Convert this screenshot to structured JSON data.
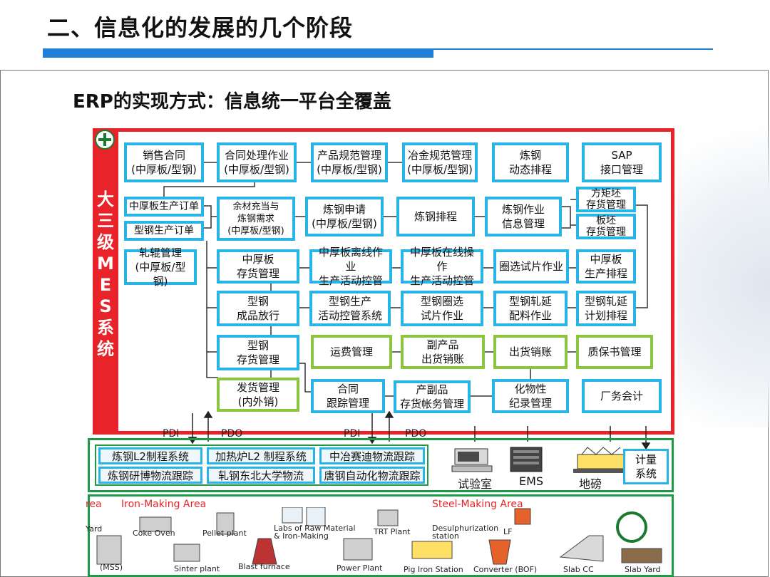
{
  "slide": {
    "title": "二、信息化的发展的几个阶段",
    "subtitle": "ERP的实现方式：信息统一平台全覆盖"
  },
  "mes": {
    "label": "大\n三\n级\nM\nE\nS\n系\n统",
    "boxes": [
      {
        "id": "b1",
        "text": "销售合同\n(中厚板/型钢)",
        "style": "blue"
      },
      {
        "id": "b2",
        "text": "合同处理作业\n(中厚板/型钢)",
        "style": "blue"
      },
      {
        "id": "b3",
        "text": "产品规范管理\n(中厚板/型钢)",
        "style": "blue"
      },
      {
        "id": "b4",
        "text": "冶金规范管理\n(中厚板/型钢)",
        "style": "blue"
      },
      {
        "id": "b5",
        "text": "炼钢\n动态排程",
        "style": "blue"
      },
      {
        "id": "b6",
        "text": "SAP\n接口管理",
        "style": "blue"
      },
      {
        "id": "b7",
        "text": "中厚板生产订单",
        "style": "blue"
      },
      {
        "id": "b8",
        "text": "型钢生产订单",
        "style": "blue"
      },
      {
        "id": "b9",
        "text": "余材充当与\n炼钢需求\n(中厚板/型钢)",
        "style": "blue"
      },
      {
        "id": "b10",
        "text": "炼钢申请\n(中厚板/型钢)",
        "style": "blue"
      },
      {
        "id": "b11",
        "text": "炼钢排程",
        "style": "blue"
      },
      {
        "id": "b12",
        "text": "炼钢作业\n信息管理",
        "style": "blue"
      },
      {
        "id": "b13",
        "text": "方矩坯\n存货管理",
        "style": "blue"
      },
      {
        "id": "b14",
        "text": "板坯\n存货管理",
        "style": "blue"
      },
      {
        "id": "b15",
        "text": "轧辊管理\n(中厚板/型钢)",
        "style": "blue"
      },
      {
        "id": "b16",
        "text": "中厚板\n存货管理",
        "style": "blue"
      },
      {
        "id": "b17",
        "text": "中厚板离线作业\n生产活动控管",
        "style": "blue"
      },
      {
        "id": "b18",
        "text": "中厚板在线操作\n生产活动控管",
        "style": "blue"
      },
      {
        "id": "b19",
        "text": "圈选试片作业",
        "style": "blue"
      },
      {
        "id": "b20",
        "text": "中厚板\n生产排程",
        "style": "blue"
      },
      {
        "id": "b21",
        "text": "型钢\n成品放行",
        "style": "blue"
      },
      {
        "id": "b22",
        "text": "型钢生产\n活动控管系统",
        "style": "blue"
      },
      {
        "id": "b23",
        "text": "型钢圈选\n试片作业",
        "style": "blue"
      },
      {
        "id": "b24",
        "text": "型钢轧延\n配料作业",
        "style": "blue"
      },
      {
        "id": "b25",
        "text": "型钢轧延\n计划排程",
        "style": "blue"
      },
      {
        "id": "b26",
        "text": "型钢\n存货管理",
        "style": "blue"
      },
      {
        "id": "b27",
        "text": "运费管理",
        "style": "green"
      },
      {
        "id": "b28",
        "text": "副产品\n出货销账",
        "style": "green"
      },
      {
        "id": "b29",
        "text": "出货销账",
        "style": "green"
      },
      {
        "id": "b30",
        "text": "质保书管理",
        "style": "green"
      },
      {
        "id": "b31",
        "text": "发货管理\n(内外销)",
        "style": "green"
      },
      {
        "id": "b32",
        "text": "合同\n跟踪管理",
        "style": "blue"
      },
      {
        "id": "b33",
        "text": "产副品\n存货帐务管理",
        "style": "blue"
      },
      {
        "id": "b34",
        "text": "化物性\n纪录管理",
        "style": "blue"
      },
      {
        "id": "b35",
        "text": "厂务会计",
        "style": "blue"
      }
    ]
  },
  "interface_labels": {
    "pdi": "PDI",
    "pdo": "PDO"
  },
  "level2": {
    "systems": [
      "炼钢L2制程系统",
      "加热炉L2 制程系统",
      "中冶赛迪物流跟踪",
      "炼钢研博物流跟踪",
      "轧钢东北大学物流",
      "唐钢自动化物流跟踪"
    ],
    "devices": [
      "试验室",
      "EMS",
      "地磅"
    ],
    "metering": "计量\n系统"
  },
  "level1": {
    "areas": [
      "rea",
      "Iron-Making Area",
      "Steel-Making Area"
    ],
    "plants": [
      "Yard",
      "Coke Oven",
      "Pellet plant",
      "Labs of Raw Material\n& Iron-Making",
      "TRT Plant",
      "Desulphurization\nstation",
      "LF",
      "(MSS)",
      "Sinter plant",
      "Blast furnace",
      "Power Plant",
      "Pig Iron Station",
      "Converter (BOF)",
      "Slab CC",
      "Slab Yard"
    ]
  },
  "colors": {
    "accent_blue": "#1f7ed8",
    "mes_red": "#e8232a",
    "box_blue": "#29b4e8",
    "box_green": "#8cc63e",
    "frame_green": "#1d9a48"
  }
}
